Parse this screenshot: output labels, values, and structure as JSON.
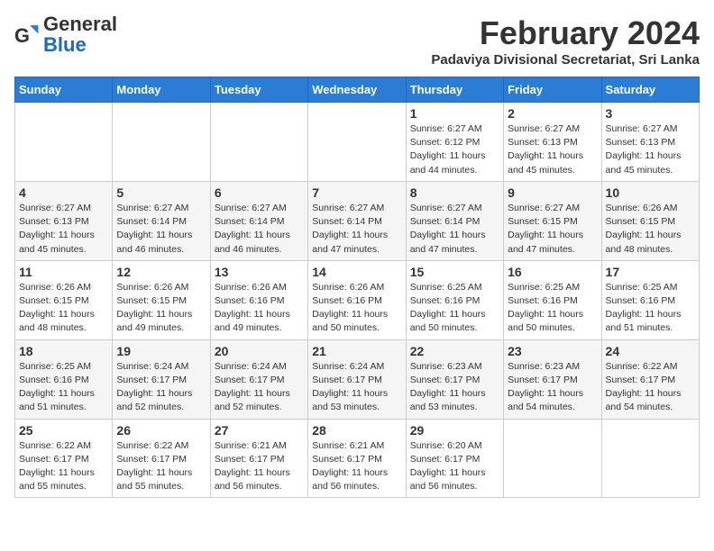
{
  "header": {
    "logo_general": "General",
    "logo_blue": "Blue",
    "month_title": "February 2024",
    "subtitle": "Padaviya Divisional Secretariat, Sri Lanka"
  },
  "days_of_week": [
    "Sunday",
    "Monday",
    "Tuesday",
    "Wednesday",
    "Thursday",
    "Friday",
    "Saturday"
  ],
  "weeks": [
    [
      {
        "day": "",
        "info": ""
      },
      {
        "day": "",
        "info": ""
      },
      {
        "day": "",
        "info": ""
      },
      {
        "day": "",
        "info": ""
      },
      {
        "day": "1",
        "info": "Sunrise: 6:27 AM\nSunset: 6:12 PM\nDaylight: 11 hours\nand 44 minutes."
      },
      {
        "day": "2",
        "info": "Sunrise: 6:27 AM\nSunset: 6:13 PM\nDaylight: 11 hours\nand 45 minutes."
      },
      {
        "day": "3",
        "info": "Sunrise: 6:27 AM\nSunset: 6:13 PM\nDaylight: 11 hours\nand 45 minutes."
      }
    ],
    [
      {
        "day": "4",
        "info": "Sunrise: 6:27 AM\nSunset: 6:13 PM\nDaylight: 11 hours\nand 45 minutes."
      },
      {
        "day": "5",
        "info": "Sunrise: 6:27 AM\nSunset: 6:14 PM\nDaylight: 11 hours\nand 46 minutes."
      },
      {
        "day": "6",
        "info": "Sunrise: 6:27 AM\nSunset: 6:14 PM\nDaylight: 11 hours\nand 46 minutes."
      },
      {
        "day": "7",
        "info": "Sunrise: 6:27 AM\nSunset: 6:14 PM\nDaylight: 11 hours\nand 47 minutes."
      },
      {
        "day": "8",
        "info": "Sunrise: 6:27 AM\nSunset: 6:14 PM\nDaylight: 11 hours\nand 47 minutes."
      },
      {
        "day": "9",
        "info": "Sunrise: 6:27 AM\nSunset: 6:15 PM\nDaylight: 11 hours\nand 47 minutes."
      },
      {
        "day": "10",
        "info": "Sunrise: 6:26 AM\nSunset: 6:15 PM\nDaylight: 11 hours\nand 48 minutes."
      }
    ],
    [
      {
        "day": "11",
        "info": "Sunrise: 6:26 AM\nSunset: 6:15 PM\nDaylight: 11 hours\nand 48 minutes."
      },
      {
        "day": "12",
        "info": "Sunrise: 6:26 AM\nSunset: 6:15 PM\nDaylight: 11 hours\nand 49 minutes."
      },
      {
        "day": "13",
        "info": "Sunrise: 6:26 AM\nSunset: 6:16 PM\nDaylight: 11 hours\nand 49 minutes."
      },
      {
        "day": "14",
        "info": "Sunrise: 6:26 AM\nSunset: 6:16 PM\nDaylight: 11 hours\nand 50 minutes."
      },
      {
        "day": "15",
        "info": "Sunrise: 6:25 AM\nSunset: 6:16 PM\nDaylight: 11 hours\nand 50 minutes."
      },
      {
        "day": "16",
        "info": "Sunrise: 6:25 AM\nSunset: 6:16 PM\nDaylight: 11 hours\nand 50 minutes."
      },
      {
        "day": "17",
        "info": "Sunrise: 6:25 AM\nSunset: 6:16 PM\nDaylight: 11 hours\nand 51 minutes."
      }
    ],
    [
      {
        "day": "18",
        "info": "Sunrise: 6:25 AM\nSunset: 6:16 PM\nDaylight: 11 hours\nand 51 minutes."
      },
      {
        "day": "19",
        "info": "Sunrise: 6:24 AM\nSunset: 6:17 PM\nDaylight: 11 hours\nand 52 minutes."
      },
      {
        "day": "20",
        "info": "Sunrise: 6:24 AM\nSunset: 6:17 PM\nDaylight: 11 hours\nand 52 minutes."
      },
      {
        "day": "21",
        "info": "Sunrise: 6:24 AM\nSunset: 6:17 PM\nDaylight: 11 hours\nand 53 minutes."
      },
      {
        "day": "22",
        "info": "Sunrise: 6:23 AM\nSunset: 6:17 PM\nDaylight: 11 hours\nand 53 minutes."
      },
      {
        "day": "23",
        "info": "Sunrise: 6:23 AM\nSunset: 6:17 PM\nDaylight: 11 hours\nand 54 minutes."
      },
      {
        "day": "24",
        "info": "Sunrise: 6:22 AM\nSunset: 6:17 PM\nDaylight: 11 hours\nand 54 minutes."
      }
    ],
    [
      {
        "day": "25",
        "info": "Sunrise: 6:22 AM\nSunset: 6:17 PM\nDaylight: 11 hours\nand 55 minutes."
      },
      {
        "day": "26",
        "info": "Sunrise: 6:22 AM\nSunset: 6:17 PM\nDaylight: 11 hours\nand 55 minutes."
      },
      {
        "day": "27",
        "info": "Sunrise: 6:21 AM\nSunset: 6:17 PM\nDaylight: 11 hours\nand 56 minutes."
      },
      {
        "day": "28",
        "info": "Sunrise: 6:21 AM\nSunset: 6:17 PM\nDaylight: 11 hours\nand 56 minutes."
      },
      {
        "day": "29",
        "info": "Sunrise: 6:20 AM\nSunset: 6:17 PM\nDaylight: 11 hours\nand 56 minutes."
      },
      {
        "day": "",
        "info": ""
      },
      {
        "day": "",
        "info": ""
      }
    ]
  ]
}
